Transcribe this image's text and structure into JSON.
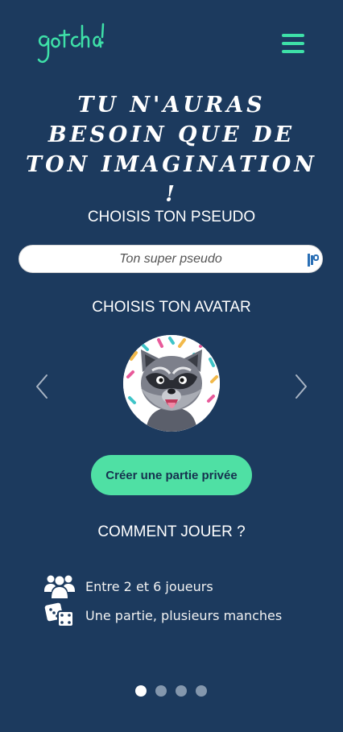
{
  "header": {
    "logo_text": "gotcha!",
    "menu_icon": "hamburger-menu-icon"
  },
  "hero": {
    "headline": "Tu n'auras besoin que de ton imagination !"
  },
  "pseudo": {
    "title": "CHOISIS TON PSEUDO",
    "placeholder": "Ton super pseudo",
    "value": ""
  },
  "avatar": {
    "title": "CHOISIS TON AVATAR",
    "name": "raccoon-avatar",
    "prev_icon": "chevron-left-icon",
    "next_icon": "chevron-right-icon"
  },
  "create_button": "Créer une partie privée",
  "how_to": {
    "title": "COMMENT JOUER ?",
    "rules": [
      {
        "icon": "users-group-icon",
        "text": "Entre 2 et 6 joueurs"
      },
      {
        "icon": "dice-icon",
        "text": "Une partie, plusieurs manches"
      }
    ]
  },
  "pagination": {
    "count": 4,
    "active": 1
  },
  "colors": {
    "background": "#1c3a5e",
    "accent": "#4fe0a4",
    "text": "#ffffff"
  }
}
